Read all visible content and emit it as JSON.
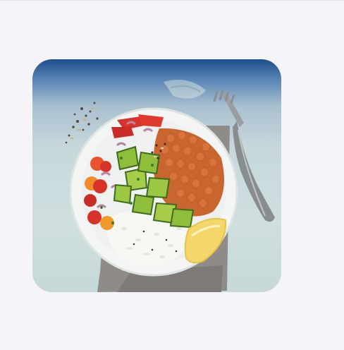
{
  "image": {
    "subject": "food-bowl-photo",
    "colors": {
      "page_background": "#f5f4f9",
      "backdrop_top": "#1e4f8c",
      "backdrop_bottom": "#c6d8d8",
      "plate": "#f4f6f5",
      "napkin": "#8f8c88",
      "chickpeas": "#d9733e",
      "rice": "#f7f7f3",
      "avocado": "#8fbf3a",
      "tomato": "#d8332a",
      "lemon": "#f4d66a",
      "fork": "#8a8d90"
    }
  }
}
